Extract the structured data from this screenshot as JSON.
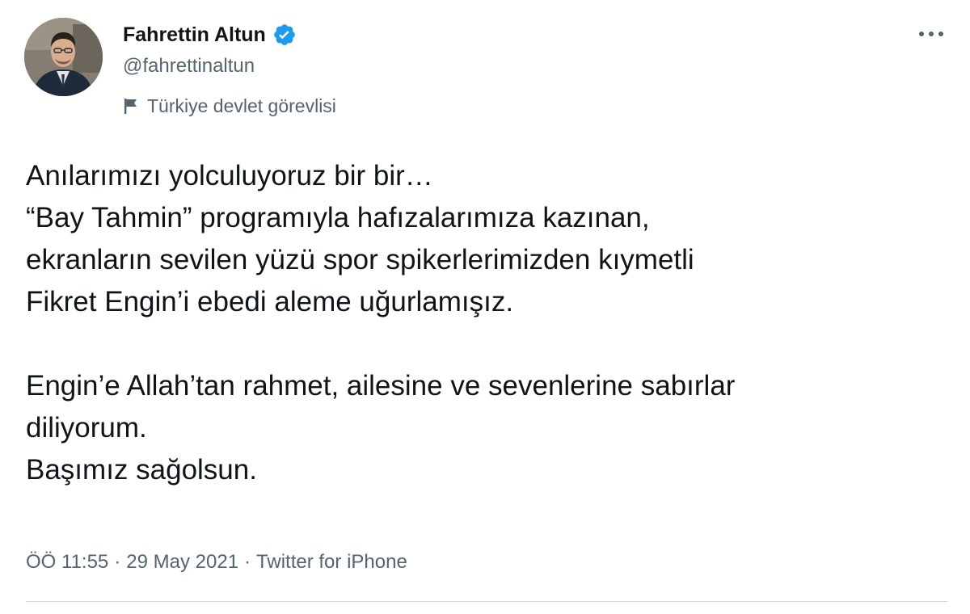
{
  "author": {
    "display_name": "Fahrettin Altun",
    "handle": "@fahrettinaltun",
    "verified": true,
    "verified_color": "#1d9bf0",
    "label": "Türkiye devlet görevlisi",
    "label_icon": "flag-icon",
    "avatar_icon": "avatar"
  },
  "tweet": {
    "paragraph_1": [
      "Anılarımızı yolculuyoruz bir bir…",
      "“Bay Tahmin” programıyla hafızalarımıza kazınan,",
      "ekranların sevilen yüzü spor spikerlerimizden kıymetli",
      "Fikret Engin’i ebedi aleme uğurlamışız."
    ],
    "paragraph_2": [
      "Engin’e Allah’tan rahmet, ailesine ve sevenlerine sabırlar",
      "diliyorum.",
      "Başımız sağolsun."
    ]
  },
  "meta": {
    "time": "ÖÖ 11:55",
    "separator": "·",
    "date": "29 May 2021",
    "source": "Twitter for iPhone"
  },
  "menu": {
    "icon": "more-dots-icon"
  },
  "colors": {
    "text": "#0f1419",
    "secondary": "#536471",
    "divider": "#cfd9de",
    "background": "#ffffff"
  }
}
